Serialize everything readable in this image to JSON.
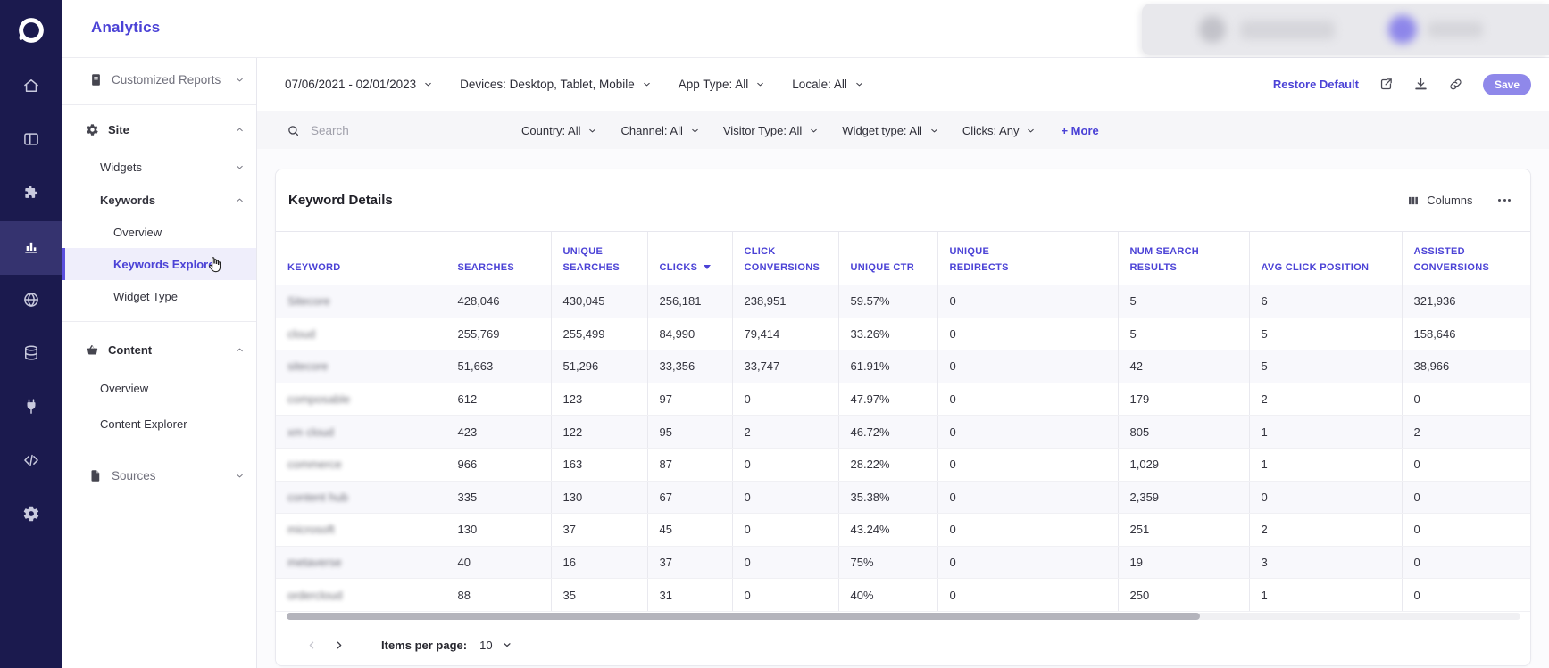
{
  "app": {
    "title": "Analytics"
  },
  "colors": {
    "accent": "#4b42d6",
    "sidebar_bg": "#1b1a4e",
    "save_bg": "#8f88ea",
    "active_row_bg": "#efeefb"
  },
  "primary_nav": {
    "logo_icon": "sitecore-logo-icon",
    "items": [
      {
        "name": "home",
        "icon": "home-icon",
        "active": false
      },
      {
        "name": "dashboard",
        "icon": "dashboard-icon",
        "active": false
      },
      {
        "name": "extensions",
        "icon": "puzzle-icon",
        "active": false
      },
      {
        "name": "analytics",
        "icon": "bar-chart-icon",
        "active": true
      },
      {
        "name": "domains",
        "icon": "globe-icon",
        "active": false
      },
      {
        "name": "data",
        "icon": "database-icon",
        "active": false
      },
      {
        "name": "connectors",
        "icon": "plug-icon",
        "active": false
      },
      {
        "name": "developer",
        "icon": "code-icon",
        "active": false
      },
      {
        "name": "settings",
        "icon": "gear-icon",
        "active": false
      }
    ]
  },
  "secondary_nav": {
    "items": [
      {
        "type": "item",
        "name": "customized-reports",
        "icon": "report-icon",
        "label": "Customized Reports",
        "chevron": "down",
        "style": "top"
      },
      {
        "type": "divider"
      },
      {
        "type": "item",
        "name": "site",
        "icon": "gear-icon",
        "label": "Site",
        "chevron": "up",
        "style": "group"
      },
      {
        "type": "item",
        "name": "widgets",
        "label": "Widgets",
        "chevron": "down",
        "style": "sub1"
      },
      {
        "type": "item",
        "name": "keywords",
        "label": "Keywords",
        "chevron": "up",
        "style": "sub1",
        "bold": true
      },
      {
        "type": "item",
        "name": "keywords-overview",
        "label": "Overview",
        "style": "sub2"
      },
      {
        "type": "item",
        "name": "keywords-explorer",
        "label": "Keywords Explorer",
        "style": "sub2",
        "active": true
      },
      {
        "type": "item",
        "name": "widget-type",
        "label": "Widget Type",
        "style": "sub2"
      },
      {
        "type": "divider",
        "mt": "snav-mt10"
      },
      {
        "type": "item",
        "name": "content",
        "icon": "basket-icon",
        "label": "Content",
        "chevron": "up",
        "style": "group",
        "mt": "snav-mt8"
      },
      {
        "type": "item",
        "name": "content-overview",
        "label": "Overview",
        "style": "sub1x"
      },
      {
        "type": "item",
        "name": "content-explorer",
        "label": "Content Explorer",
        "style": "sub1x"
      },
      {
        "type": "divider",
        "mt": "snav-mt8"
      },
      {
        "type": "item",
        "name": "sources",
        "icon": "document-icon",
        "label": "Sources",
        "chevron": "down",
        "style": "top2"
      }
    ]
  },
  "toolbar": {
    "filters": [
      {
        "name": "date-range-filter",
        "label": "07/06/2021 - 02/01/2023"
      },
      {
        "name": "devices-filter",
        "label": "Devices: Desktop, Tablet, Mobile"
      },
      {
        "name": "app-type-filter",
        "label": "App Type: All"
      },
      {
        "name": "locale-filter",
        "label": "Locale: All"
      }
    ],
    "restore_default": "Restore Default",
    "actions": [
      {
        "name": "share",
        "icon": "share-icon"
      },
      {
        "name": "download",
        "icon": "download-icon"
      },
      {
        "name": "link",
        "icon": "link-icon"
      }
    ],
    "save_label": "Save"
  },
  "filterbar": {
    "search_placeholder": "Search",
    "filters": [
      {
        "name": "country-filter",
        "label": "Country: All"
      },
      {
        "name": "channel-filter",
        "label": "Channel: All"
      },
      {
        "name": "visitor-type-filter",
        "label": "Visitor Type: All"
      },
      {
        "name": "widget-type-filter",
        "label": "Widget type: All"
      },
      {
        "name": "clicks-filter",
        "label": "Clicks: Any"
      }
    ],
    "more_label": "+ More"
  },
  "table": {
    "title": "Keyword Details",
    "columns_label": "Columns",
    "headers": [
      {
        "name": "keyword",
        "lines": [
          "KEYWORD"
        ]
      },
      {
        "name": "searches",
        "lines": [
          "SEARCHES"
        ]
      },
      {
        "name": "unique-searches",
        "lines": [
          "UNIQUE",
          "SEARCHES"
        ]
      },
      {
        "name": "clicks",
        "lines": [
          "CLICKS"
        ],
        "sort": "desc"
      },
      {
        "name": "click-conversions",
        "lines": [
          "CLICK",
          "CONVERSIONS"
        ]
      },
      {
        "name": "unique-ctr",
        "lines": [
          "UNIQUE CTR"
        ]
      },
      {
        "name": "unique-redirects",
        "lines": [
          "UNIQUE",
          "REDIRECTS"
        ]
      },
      {
        "name": "num-search-results",
        "lines": [
          "NUM SEARCH",
          "RESULTS"
        ]
      },
      {
        "name": "avg-click-position",
        "lines": [
          "AVG CLICK POSITION"
        ]
      },
      {
        "name": "assisted-conversions",
        "lines": [
          "ASSISTED",
          "CONVERSIONS"
        ]
      }
    ],
    "rows": [
      {
        "keyword": "Sitecore",
        "values": [
          "428,046",
          "430,045",
          "256,181",
          "238,951",
          "59.57%",
          "0",
          "5",
          "6",
          "321,936"
        ]
      },
      {
        "keyword": "cloud",
        "values": [
          "255,769",
          "255,499",
          "84,990",
          "79,414",
          "33.26%",
          "0",
          "5",
          "5",
          "158,646"
        ]
      },
      {
        "keyword": "sitecore",
        "values": [
          "51,663",
          "51,296",
          "33,356",
          "33,747",
          "61.91%",
          "0",
          "42",
          "5",
          "38,966"
        ]
      },
      {
        "keyword": "composable",
        "values": [
          "612",
          "123",
          "97",
          "0",
          "47.97%",
          "0",
          "179",
          "2",
          "0"
        ]
      },
      {
        "keyword": "xm cloud",
        "values": [
          "423",
          "122",
          "95",
          "2",
          "46.72%",
          "0",
          "805",
          "1",
          "2"
        ]
      },
      {
        "keyword": "commerce",
        "values": [
          "966",
          "163",
          "87",
          "0",
          "28.22%",
          "0",
          "1,029",
          "1",
          "0"
        ]
      },
      {
        "keyword": "content hub",
        "values": [
          "335",
          "130",
          "67",
          "0",
          "35.38%",
          "0",
          "2,359",
          "0",
          "0"
        ]
      },
      {
        "keyword": "microsoft",
        "values": [
          "130",
          "37",
          "45",
          "0",
          "43.24%",
          "0",
          "251",
          "2",
          "0"
        ]
      },
      {
        "keyword": "metaverse",
        "values": [
          "40",
          "16",
          "37",
          "0",
          "75%",
          "0",
          "19",
          "3",
          "0"
        ]
      },
      {
        "keyword": "ordercloud",
        "values": [
          "88",
          "35",
          "31",
          "0",
          "40%",
          "0",
          "250",
          "1",
          "0"
        ]
      }
    ]
  },
  "pagination": {
    "items_per_page_label": "Items per page:",
    "items_per_page_value": "10"
  }
}
